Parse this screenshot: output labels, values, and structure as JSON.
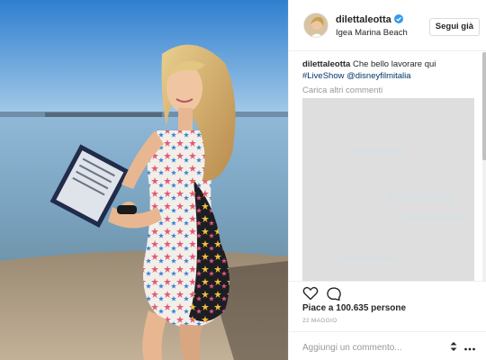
{
  "post": {
    "username": "dilettaleotta",
    "verified": true,
    "location": "Igea Marina Beach",
    "follow_label": "Segui già"
  },
  "caption": {
    "username": "dilettaleotta",
    "text": "Che bello lavorare qui",
    "hashtag": "#LiveShow",
    "mention": "@disneyfilmitalia"
  },
  "load_more_label": "Carica altri commenti",
  "likes_text": "Piace a 100.635 persone",
  "date_text": "22 MAGGIO",
  "comment_placeholder": "Aggiungi un commento...",
  "icons": {
    "verified": "verified-badge-icon",
    "like": "heart-icon",
    "comment": "comment-bubble-icon",
    "stepper": "stepper-icon",
    "more": "more-options-icon"
  },
  "colors": {
    "verified": "#3897f0",
    "link": "#003569",
    "muted": "#999999",
    "text": "#262626",
    "overlay": "#dedede"
  }
}
